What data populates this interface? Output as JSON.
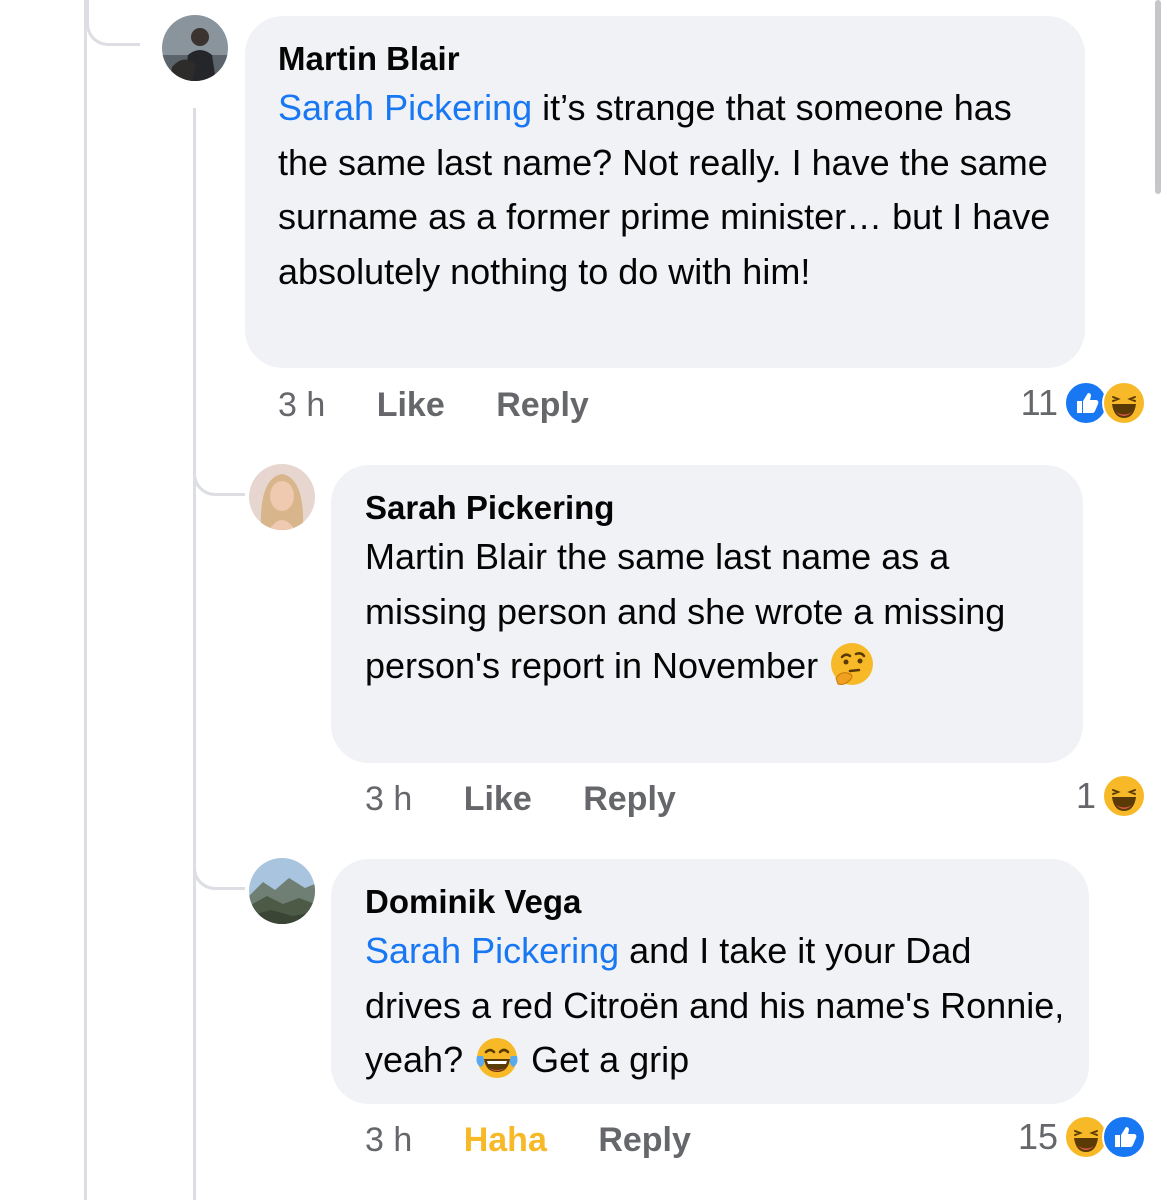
{
  "comments": [
    {
      "author": "Martin Blair",
      "mention": "Sarah Pickering",
      "text": " it’s strange that someone has the same last name? Not really. I have the same surname as a former prime minister… but I have absolutely nothing to do with him!",
      "time": "3 h",
      "like_label": "Like",
      "reply_label": "Reply",
      "reaction_count": "11",
      "reactions": [
        "like-icon",
        "haha-icon"
      ]
    },
    {
      "author": "Sarah Pickering",
      "text": "Martin Blair the same last name as a missing person and she wrote a missing person's report in November ",
      "emoji": "thinking-face-emoji",
      "time": "3 h",
      "like_label": "Like",
      "reply_label": "Reply",
      "reaction_count": "1",
      "reactions": [
        "haha-icon"
      ]
    },
    {
      "author": "Dominik Vega",
      "mention": "Sarah Pickering",
      "text_before_emoji": " and I take it your Dad drives a red Citroën and his name's Ronnie, yeah? ",
      "emoji": "tears-of-joy-emoji",
      "text_after_emoji": " Get a grip",
      "time": "3 h",
      "like_label": "Haha",
      "reply_label": "Reply",
      "reaction_count": "15",
      "reactions": [
        "haha-icon",
        "like-icon"
      ]
    }
  ],
  "colors": {
    "mention": "#1877f2",
    "bubble": "#f0f2f5",
    "meta": "#65676b",
    "haha_active": "#f7b928"
  }
}
